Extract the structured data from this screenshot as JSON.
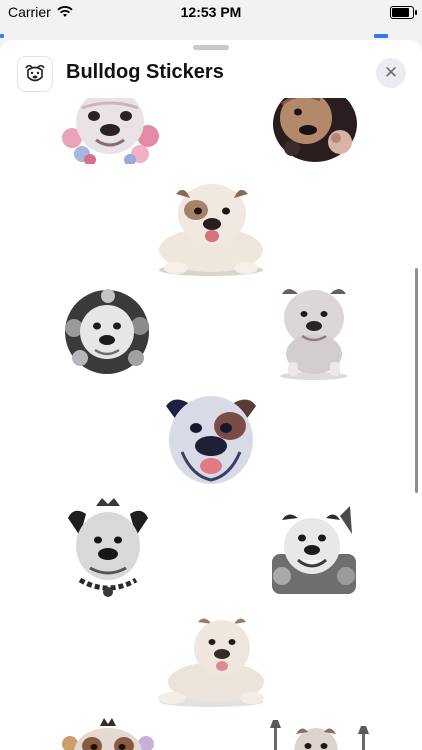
{
  "status": {
    "carrier": "Carrier",
    "time": "12:53 PM",
    "battery_level": 0.95
  },
  "sheet": {
    "title": "Bulldog Stickers",
    "close_label": "✕"
  },
  "stickers": [
    {
      "name": "sticker-bulldog-pink-flowers",
      "style": "floral"
    },
    {
      "name": "sticker-bulldog-dark-roses",
      "style": "floral"
    },
    {
      "name": "sticker-bulldog-fawn-lying",
      "style": "realistic"
    },
    {
      "name": "sticker-bulldog-grey-flowers",
      "style": "sketch"
    },
    {
      "name": "sticker-bulldog-white-standing",
      "style": "realistic"
    },
    {
      "name": "sticker-bulldog-blue-face",
      "style": "illustrated"
    },
    {
      "name": "sticker-bulldog-crown-chain",
      "style": "sketch"
    },
    {
      "name": "sticker-bulldog-sketch-smiling",
      "style": "sketch"
    },
    {
      "name": "sticker-bulldog-cream-lying",
      "style": "realistic"
    },
    {
      "name": "sticker-bulldog-crown-partial",
      "style": "illustrated"
    },
    {
      "name": "sticker-bulldog-street-lamp-partial",
      "style": "illustrated"
    }
  ]
}
